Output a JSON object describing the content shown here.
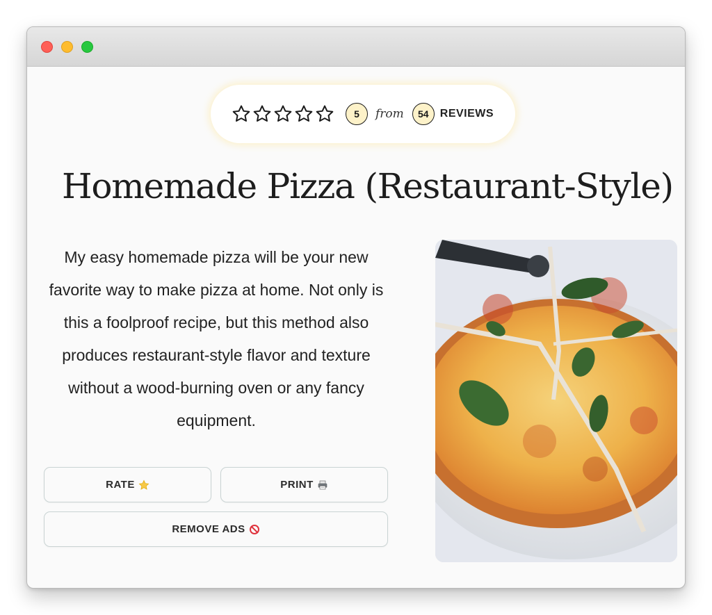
{
  "rating": {
    "score": "5",
    "from_text": "from",
    "review_count": "54",
    "reviews_label": "REVIEWS",
    "stars_filled": 0,
    "stars_total": 5
  },
  "recipe": {
    "title": "Homemade Pizza (Restaurant-Style)",
    "description": "My easy homemade pizza will be your new favorite way to make pizza at home. Not only is this a foolproof recipe, but this method also produces restaurant-style flavor and texture without a wood-burning oven or any fancy equipment."
  },
  "buttons": {
    "rate_label": "RATE",
    "print_label": "PRINT",
    "remove_ads_label": "REMOVE ADS"
  },
  "icons": {
    "rate": "star-icon",
    "print": "printer-icon",
    "remove_ads": "prohibited-icon"
  },
  "colors": {
    "badge_fill": "#fdf2c9",
    "pill_glow": "#ffe796",
    "button_border": "#c9d3d3",
    "title_text": "#1d1d1d"
  }
}
